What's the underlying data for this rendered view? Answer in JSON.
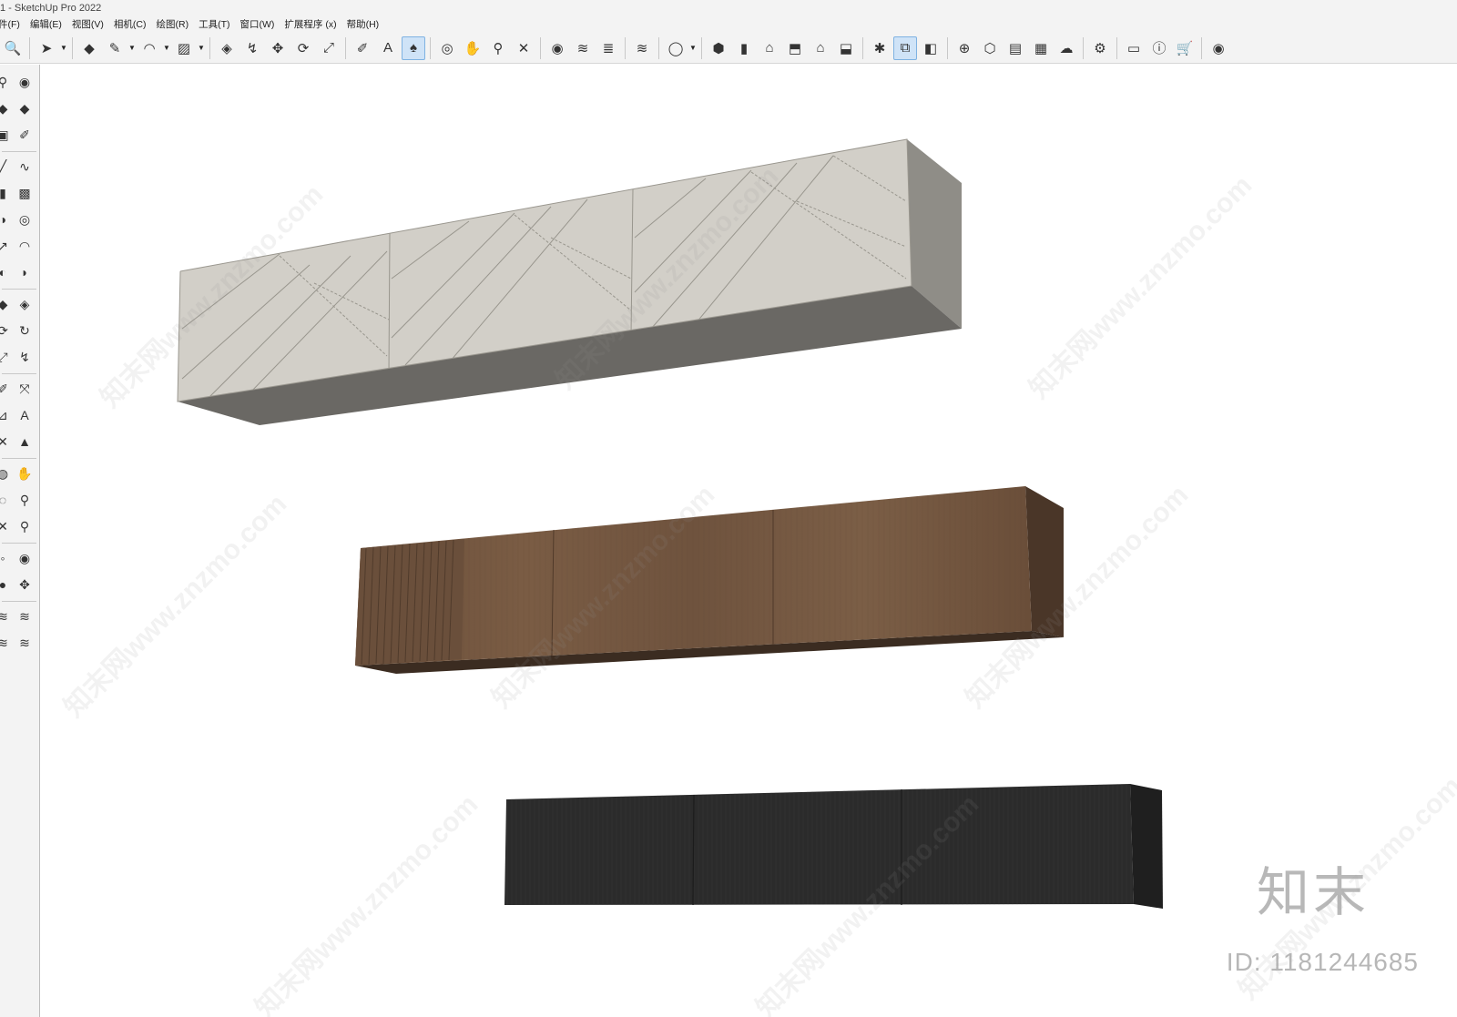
{
  "window": {
    "title": "1 - SketchUp Pro 2022"
  },
  "menu": [
    "件(F)",
    "编辑(E)",
    "视图(V)",
    "相机(C)",
    "绘图(R)",
    "工具(T)",
    "窗口(W)",
    "扩展程序 (x)",
    "帮助(H)"
  ],
  "toolbar": {
    "icons": [
      {
        "name": "zoom-icon",
        "glyph": "🔍"
      },
      {
        "sep": true
      },
      {
        "name": "select-icon",
        "glyph": "➤",
        "caret": true
      },
      {
        "sep": true
      },
      {
        "name": "eraser-icon",
        "glyph": "◆"
      },
      {
        "name": "pencil-icon",
        "glyph": "✎",
        "caret": true
      },
      {
        "name": "arc-icon",
        "glyph": "◠",
        "caret": true
      },
      {
        "name": "rectangle-icon",
        "glyph": "▨",
        "caret": true
      },
      {
        "sep": true
      },
      {
        "name": "push-pull-icon",
        "glyph": "◈"
      },
      {
        "name": "follow-me-icon",
        "glyph": "↯"
      },
      {
        "name": "move-icon",
        "glyph": "✥"
      },
      {
        "name": "rotate-icon",
        "glyph": "⟳"
      },
      {
        "name": "scale-icon",
        "glyph": "⤢"
      },
      {
        "sep": true
      },
      {
        "name": "tape-measure-icon",
        "glyph": "✐"
      },
      {
        "name": "text-icon",
        "glyph": "A"
      },
      {
        "name": "paint-bucket-icon",
        "glyph": "♠",
        "active": true
      },
      {
        "sep": true
      },
      {
        "name": "orbit-icon",
        "glyph": "◎"
      },
      {
        "name": "pan-icon",
        "glyph": "✋"
      },
      {
        "name": "zoom-tool-icon",
        "glyph": "⚲"
      },
      {
        "name": "zoom-extents-icon",
        "glyph": "✕"
      },
      {
        "sep": true
      },
      {
        "name": "warehouse-icon",
        "glyph": "◉"
      },
      {
        "name": "extension-icon",
        "glyph": "≋"
      },
      {
        "name": "layers-icon",
        "glyph": "≣"
      },
      {
        "sep": true
      },
      {
        "name": "extension-manager-icon",
        "glyph": "≋"
      },
      {
        "sep": true
      },
      {
        "name": "account-icon",
        "glyph": "◯",
        "caret": true
      },
      {
        "sep": true
      },
      {
        "name": "iso-view-icon",
        "glyph": "⬢"
      },
      {
        "name": "front-view-icon",
        "glyph": "▮"
      },
      {
        "name": "top-view-icon",
        "glyph": "⌂"
      },
      {
        "name": "right-view-icon",
        "glyph": "⬒"
      },
      {
        "name": "back-view-icon",
        "glyph": "⌂"
      },
      {
        "name": "left-view-icon",
        "glyph": "⬓"
      },
      {
        "sep": true
      },
      {
        "name": "components-icon",
        "glyph": "✱"
      },
      {
        "name": "outliner-icon",
        "glyph": "⧉",
        "active": true
      },
      {
        "name": "scenes-icon",
        "glyph": "◧"
      },
      {
        "sep": true
      },
      {
        "name": "add-location-icon",
        "glyph": "⊕"
      },
      {
        "name": "shadow-icon",
        "glyph": "⬡"
      },
      {
        "name": "styles-icon",
        "glyph": "▤"
      },
      {
        "name": "texture-icon",
        "glyph": "▦"
      },
      {
        "name": "cloud-icon",
        "glyph": "☁"
      },
      {
        "sep": true
      },
      {
        "name": "settings-icon",
        "glyph": "⚙"
      },
      {
        "sep": true
      },
      {
        "name": "chat-icon",
        "glyph": "▭"
      },
      {
        "name": "info-icon",
        "glyph": "ⓘ"
      },
      {
        "name": "cart-icon",
        "glyph": "🛒"
      },
      {
        "sep": true
      },
      {
        "name": "user-profile-icon",
        "glyph": "◉"
      }
    ]
  },
  "lefttools": [
    {
      "a": "⚲",
      "b": "◉",
      "an": "zoom-icon",
      "bn": "orbit-icon"
    },
    {
      "a": "◆",
      "b": "◆",
      "an": "paint-icon",
      "bn": "eraser-icon"
    },
    {
      "a": "▣",
      "b": "✐",
      "an": "component-icon",
      "bn": "tape-icon"
    },
    {
      "sep": true
    },
    {
      "a": "╱",
      "b": "∿",
      "an": "line-icon",
      "bn": "freehand-icon"
    },
    {
      "a": "▮",
      "b": "▩",
      "an": "rectangle-icon",
      "bn": "rotated-rect-icon"
    },
    {
      "a": "◑",
      "b": "◎",
      "an": "circle-icon",
      "bn": "polygon-icon"
    },
    {
      "a": "↗",
      "b": "◠",
      "an": "arc-icon",
      "bn": "arc2-icon"
    },
    {
      "a": "◐",
      "b": "◗",
      "an": "pie-icon",
      "bn": "arc3-icon"
    },
    {
      "sep": true
    },
    {
      "a": "◆",
      "b": "◈",
      "an": "move-icon",
      "bn": "push-pull-icon"
    },
    {
      "a": "⟳",
      "b": "↻",
      "an": "rotate-icon",
      "bn": "follow-me-icon"
    },
    {
      "a": "⤢",
      "b": "↯",
      "an": "scale-icon",
      "bn": "offset-icon"
    },
    {
      "sep": true
    },
    {
      "a": "✐",
      "b": "⤧",
      "an": "tape-measure-icon",
      "bn": "dimension-icon"
    },
    {
      "a": "⊿",
      "b": "A",
      "an": "protractor-icon",
      "bn": "text-icon"
    },
    {
      "a": "✕",
      "b": "▲",
      "an": "axes-icon",
      "bn": "3d-text-icon"
    },
    {
      "sep": true
    },
    {
      "a": "◍",
      "b": "✋",
      "an": "orbit-tool-icon",
      "bn": "pan-icon"
    },
    {
      "a": "◌",
      "b": "⚲",
      "an": "zoom-window-icon",
      "bn": "zoom-icon-2"
    },
    {
      "a": "✕",
      "b": "⚲",
      "an": "zoom-extents-icon",
      "bn": "zoom-prev-icon"
    },
    {
      "sep": true
    },
    {
      "a": "◦",
      "b": "◉",
      "an": "position-camera-icon",
      "bn": "look-around-icon"
    },
    {
      "a": "●",
      "b": "✥",
      "an": "walk-icon",
      "bn": "section-plane-icon"
    },
    {
      "sep": true
    },
    {
      "a": "≋",
      "b": "≋",
      "an": "sandbox-icon",
      "bn": "sandbox2-icon"
    },
    {
      "a": "≋",
      "b": "≋",
      "an": "sandbox3-icon",
      "bn": "sandbox4-icon"
    }
  ],
  "watermark": {
    "brand": "知末",
    "id_text": "ID: 1181244685",
    "repeat_text": "知末网www.znzmo.com"
  }
}
